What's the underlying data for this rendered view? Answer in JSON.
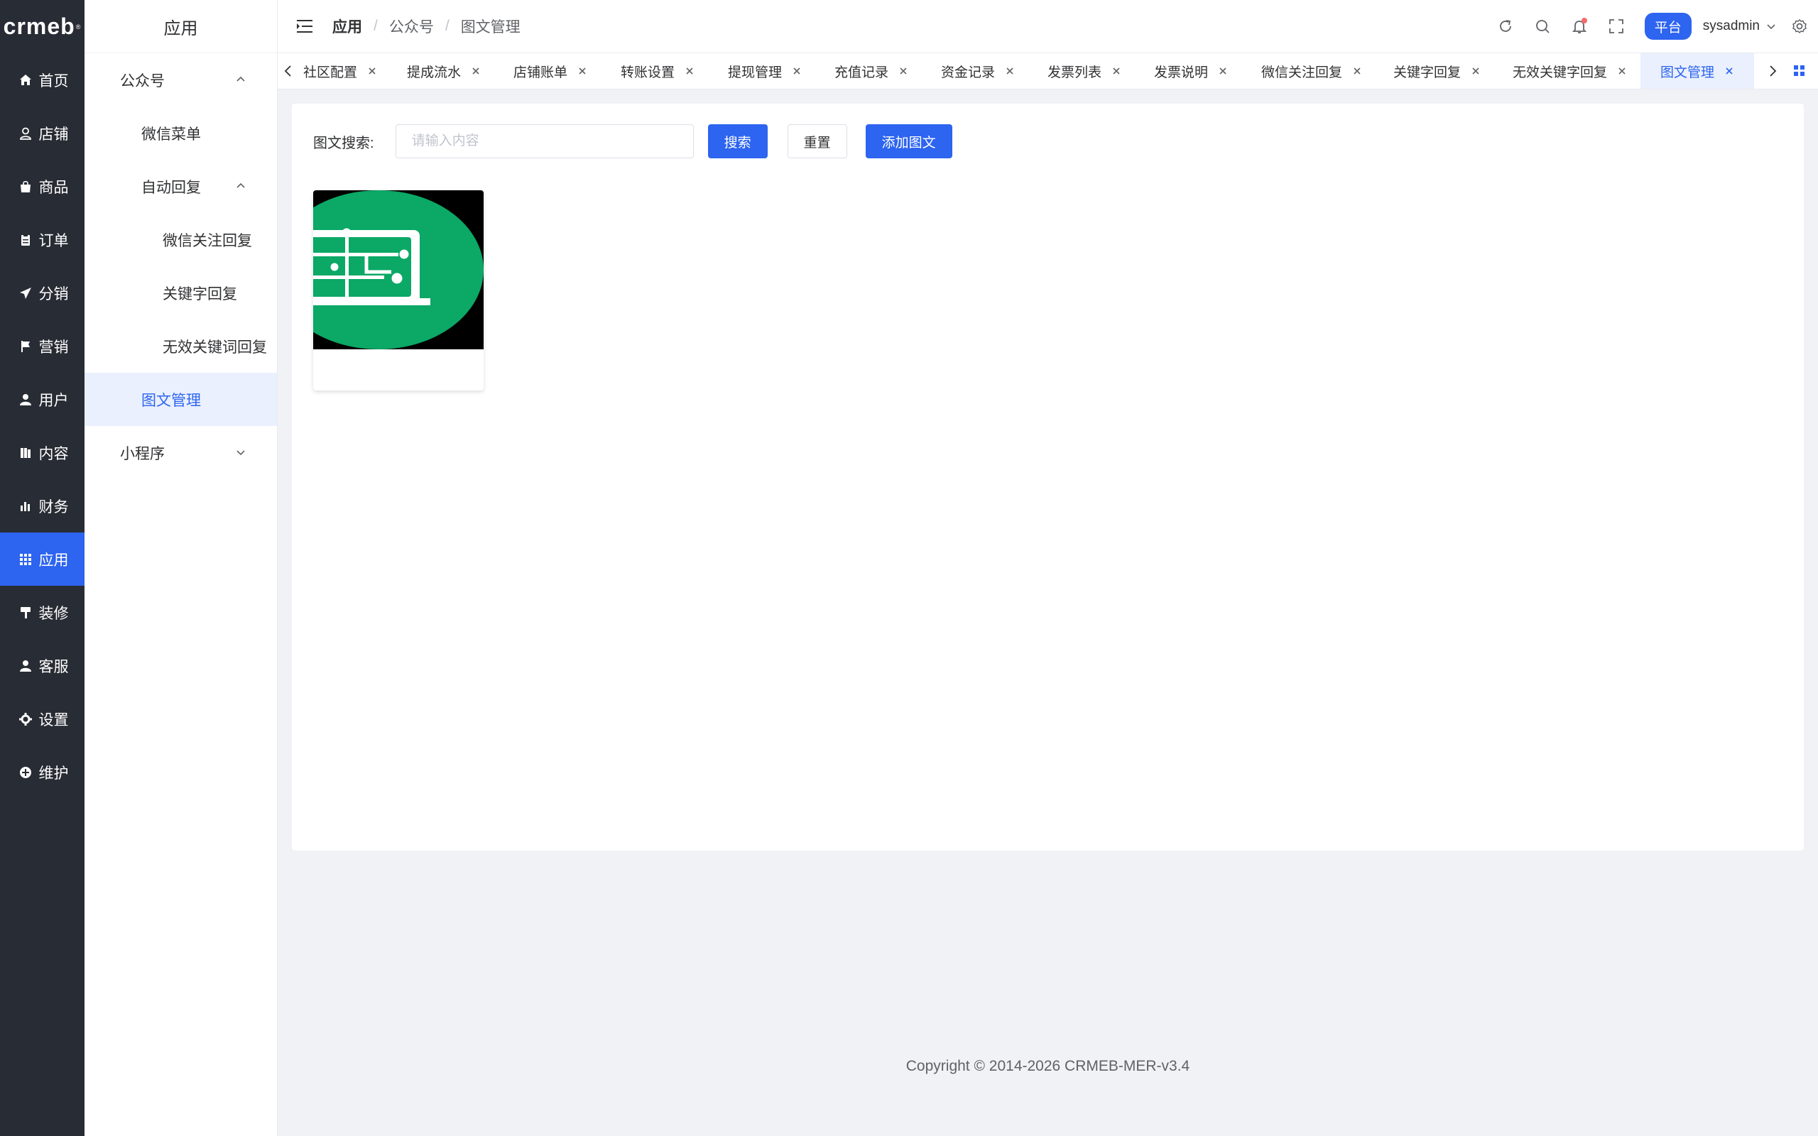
{
  "brand": {
    "logo_text": "crmeb",
    "logo_mark": "®"
  },
  "primary_nav": [
    {
      "label": "首页",
      "icon": "home-icon"
    },
    {
      "label": "店铺",
      "icon": "store-icon"
    },
    {
      "label": "商品",
      "icon": "goods-icon"
    },
    {
      "label": "订单",
      "icon": "order-icon"
    },
    {
      "label": "分销",
      "icon": "distribution-icon"
    },
    {
      "label": "营销",
      "icon": "flag-icon"
    },
    {
      "label": "用户",
      "icon": "user-icon"
    },
    {
      "label": "内容",
      "icon": "content-icon"
    },
    {
      "label": "财务",
      "icon": "finance-icon"
    },
    {
      "label": "应用",
      "icon": "apps-icon",
      "active": true
    },
    {
      "label": "装修",
      "icon": "decorate-icon"
    },
    {
      "label": "客服",
      "icon": "service-icon"
    },
    {
      "label": "设置",
      "icon": "settings-icon"
    },
    {
      "label": "维护",
      "icon": "maintenance-icon"
    }
  ],
  "secondary_nav": {
    "title": "应用",
    "items": [
      {
        "label": "公众号",
        "level": 1,
        "expanded": true
      },
      {
        "label": "微信菜单",
        "level": 2
      },
      {
        "label": "自动回复",
        "level": 2,
        "expanded": true
      },
      {
        "label": "微信关注回复",
        "level": 3
      },
      {
        "label": "关键字回复",
        "level": 3
      },
      {
        "label": "无效关键词回复",
        "level": 3
      },
      {
        "label": "图文管理",
        "level": 2,
        "active": true
      },
      {
        "label": "小程序",
        "level": 1,
        "expanded": false
      }
    ]
  },
  "header": {
    "breadcrumb": [
      "应用",
      "公众号",
      "图文管理"
    ],
    "separator": "/",
    "platform_badge": "平台",
    "username": "sysadmin"
  },
  "tabs": [
    {
      "label": "社区配置"
    },
    {
      "label": "提成流水"
    },
    {
      "label": "店铺账单"
    },
    {
      "label": "转账设置"
    },
    {
      "label": "提现管理"
    },
    {
      "label": "充值记录"
    },
    {
      "label": "资金记录"
    },
    {
      "label": "发票列表"
    },
    {
      "label": "发票说明"
    },
    {
      "label": "微信关注回复"
    },
    {
      "label": "关键字回复"
    },
    {
      "label": "无效关键字回复"
    },
    {
      "label": "图文管理",
      "active": true
    }
  ],
  "search": {
    "label": "图文搜索:",
    "placeholder": "请输入内容",
    "value": "",
    "search_button": "搜索",
    "reset_button": "重置",
    "add_button": "添加图文"
  },
  "colors": {
    "primary": "#2d64f0",
    "sidebar_bg": "#282c34",
    "thumb_green": "#0ba866"
  },
  "footer": {
    "copyright": "Copyright © 2014-2026 CRMEB-MER-v3.4"
  }
}
